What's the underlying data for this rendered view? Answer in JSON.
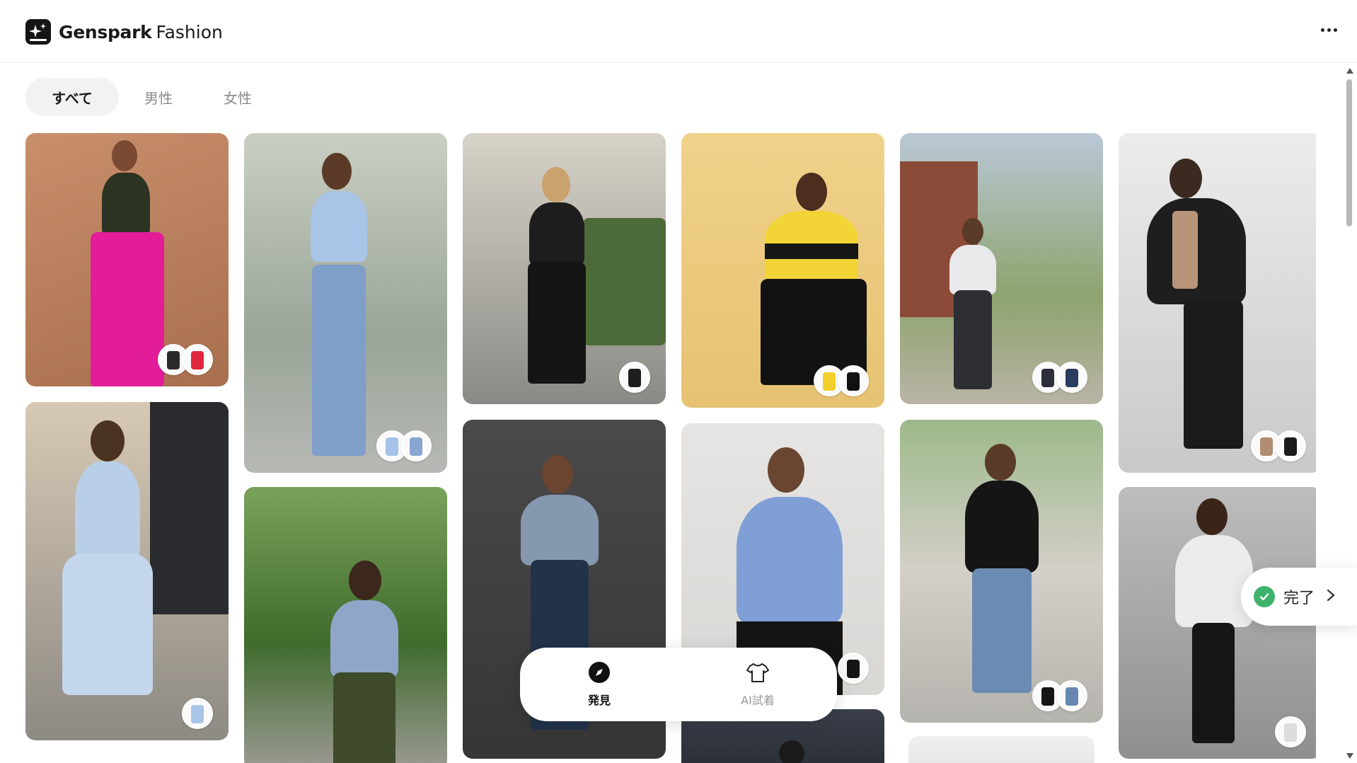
{
  "header": {
    "brand_bold": "Genspark",
    "brand_light": "Fashion",
    "logo_icon": "sparkle-icon",
    "more_icon": "more-dots-icon"
  },
  "tabs": [
    {
      "label": "すべて",
      "active": true
    },
    {
      "label": "男性",
      "active": false
    },
    {
      "label": "女性",
      "active": false
    }
  ],
  "bottom_nav": {
    "discover_label": "発見",
    "discover_icon": "compass-icon",
    "tryon_label": "AI試着",
    "tryon_icon": "tshirt-icon"
  },
  "done_toast": {
    "label": "完了",
    "icon": "check-circle-icon",
    "chevron": "chevron-right-icon"
  },
  "colors": {
    "accent_green": "#3db36b",
    "brand_dark": "#151515",
    "tab_active_bg": "#f2f2f2"
  },
  "cards": [
    {
      "id": "c1",
      "description_icon": "outfit-photo",
      "thumbs": 2
    },
    {
      "id": "c2",
      "description_icon": "outfit-photo",
      "thumbs": 2
    },
    {
      "id": "c3",
      "description_icon": "outfit-photo",
      "thumbs": 1
    },
    {
      "id": "c4",
      "description_icon": "outfit-photo",
      "thumbs": 2
    },
    {
      "id": "c5",
      "description_icon": "outfit-photo",
      "thumbs": 2
    },
    {
      "id": "c6",
      "description_icon": "outfit-photo",
      "thumbs": 2
    },
    {
      "id": "c7",
      "description_icon": "outfit-photo",
      "thumbs": 1
    },
    {
      "id": "c8",
      "description_icon": "outfit-photo",
      "thumbs": 0
    },
    {
      "id": "c9",
      "description_icon": "outfit-photo",
      "thumbs": 2
    },
    {
      "id": "c10",
      "description_icon": "outfit-photo",
      "thumbs": 1
    },
    {
      "id": "c11",
      "description_icon": "outfit-photo",
      "thumbs": 2
    },
    {
      "id": "c12",
      "description_icon": "outfit-photo",
      "thumbs": 1
    }
  ]
}
